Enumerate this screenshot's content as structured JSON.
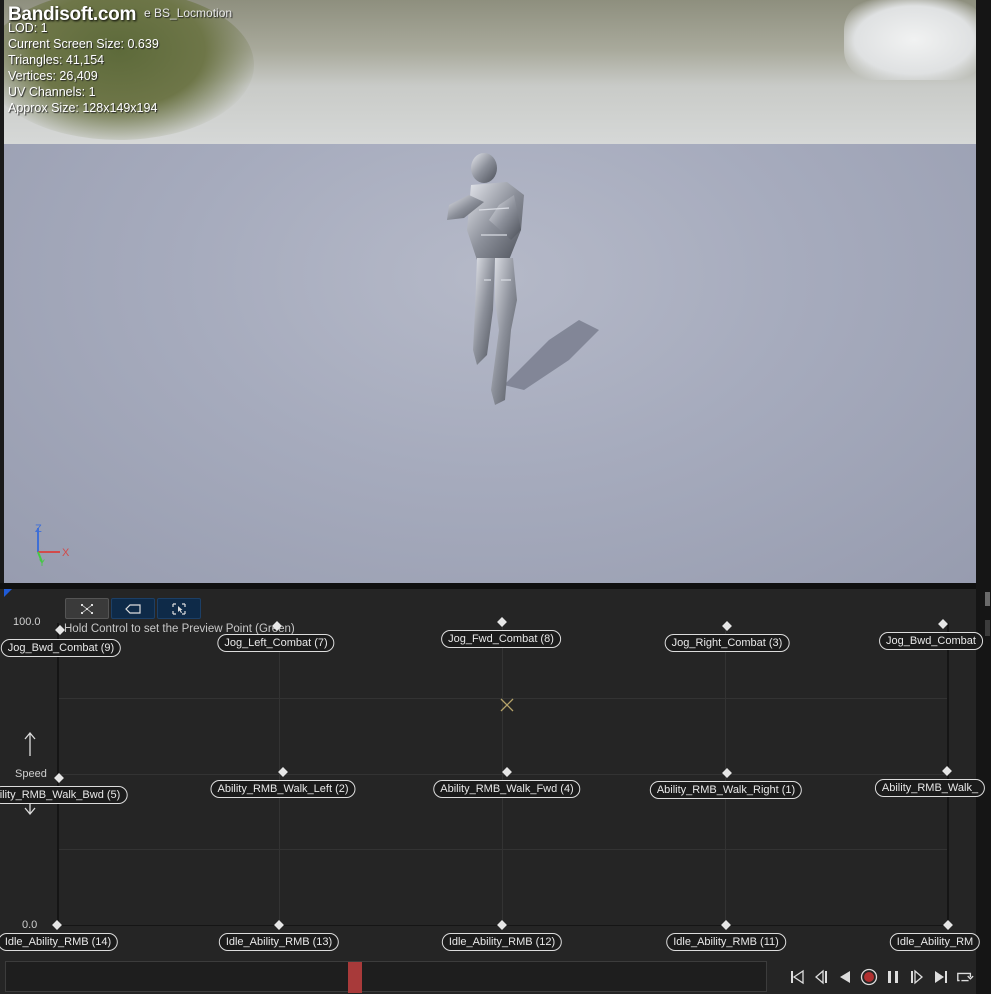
{
  "viewport": {
    "watermark": "Bandisoft.com",
    "blendspace_name": "e BS_Locmotion",
    "stats": [
      "LOD: 1",
      "Current Screen Size: 0.639",
      "Triangles: 41,154",
      "Vertices: 26,409",
      "UV Channels: 1",
      "Approx Size: 128x149x194"
    ],
    "axes": {
      "z": "Z",
      "x": "X",
      "y": "Y"
    }
  },
  "editor": {
    "toolbar": [
      {
        "icon": "grid-snap-icon"
      },
      {
        "icon": "label-tag-icon"
      },
      {
        "icon": "select-cursor-icon"
      }
    ],
    "y_max": "100.0",
    "y_min": "0.0",
    "y_axis_name": "Speed",
    "hint": "Hold Control to set the Preview Point (Green)",
    "samples_top": [
      "Jog_Bwd_Combat (9)",
      "Jog_Left_Combat (7)",
      "Jog_Fwd_Combat (8)",
      "Jog_Right_Combat (3)",
      "Jog_Bwd_Combat"
    ],
    "samples_mid": [
      "ility_RMB_Walk_Bwd (5)",
      "Ability_RMB_Walk_Left (2)",
      "Ability_RMB_Walk_Fwd (4)",
      "Ability_RMB_Walk_Right (1)",
      "Ability_RMB_Walk_"
    ],
    "samples_bottom": [
      "Idle_Ability_RMB (14)",
      "Idle_Ability_RMB (13)",
      "Idle_Ability_RMB (12)",
      "Idle_Ability_RMB (11)",
      "Idle_Ability_RM"
    ],
    "preview_point": {
      "direction_fraction": 0.5,
      "speed_value": 73.5
    }
  },
  "timeline": {
    "playhead_fraction": 0.45,
    "controls": [
      "skip-to-start-icon",
      "step-back-icon",
      "play-reverse-icon",
      "record-icon",
      "pause-icon",
      "step-forward-icon",
      "skip-to-end-icon",
      "loop-icon"
    ]
  },
  "colors": {
    "viewport_floor": "#9ea3b5",
    "editor_bg": "#252525",
    "playhead": "#a83a3a",
    "toolbar_active": "#0e2a48",
    "corner_mark": "#1f5bd8"
  }
}
